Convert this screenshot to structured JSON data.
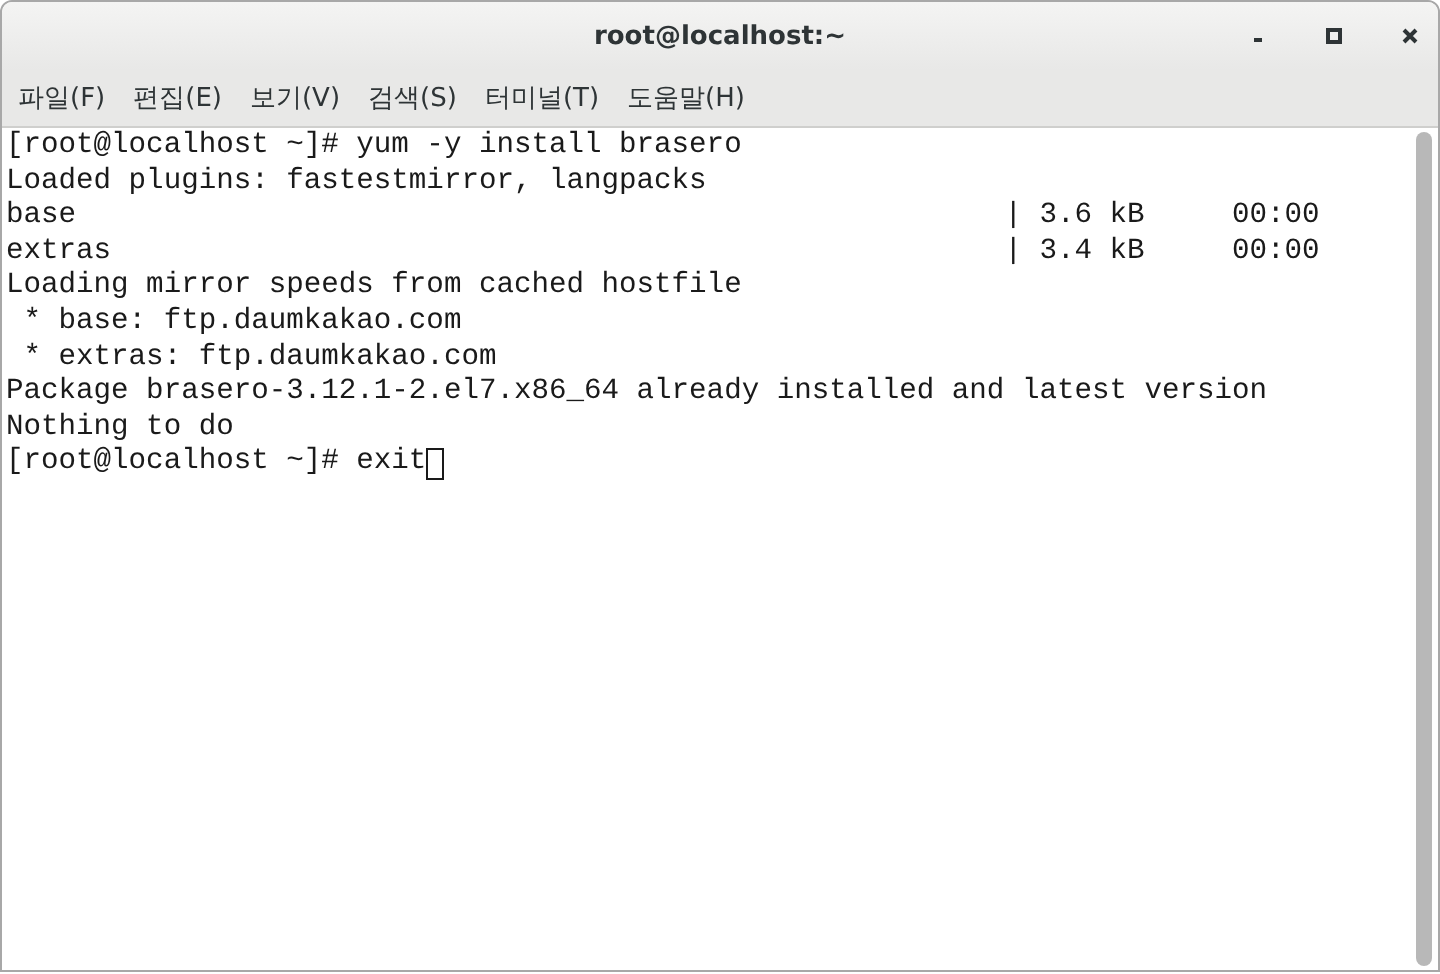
{
  "window": {
    "title": "root@localhost:~"
  },
  "menu": [
    {
      "label": "파일(F)"
    },
    {
      "label": "편집(E)"
    },
    {
      "label": "보기(V)"
    },
    {
      "label": "검색(S)"
    },
    {
      "label": "터미널(T)"
    },
    {
      "label": "도움말(H)"
    }
  ],
  "terminal": {
    "lines": [
      {
        "text": "[root@localhost ~]# yum -y install brasero"
      },
      {
        "text": "Loaded plugins: fastestmirror, langpacks"
      },
      {
        "text": "base",
        "bar": "|",
        "size": "3.6 kB",
        "time": "00:00"
      },
      {
        "text": "extras",
        "bar": "|",
        "size": "3.4 kB",
        "time": "00:00"
      },
      {
        "text": "Loading mirror speeds from cached hostfile"
      },
      {
        "text": " * base: ftp.daumkakao.com"
      },
      {
        "text": " * extras: ftp.daumkakao.com"
      },
      {
        "text": "Package brasero-3.12.1-2.el7.x86_64 already installed and latest version"
      },
      {
        "text": "Nothing to do"
      },
      {
        "text": "[root@localhost ~]# exit",
        "cursor": true
      }
    ]
  }
}
